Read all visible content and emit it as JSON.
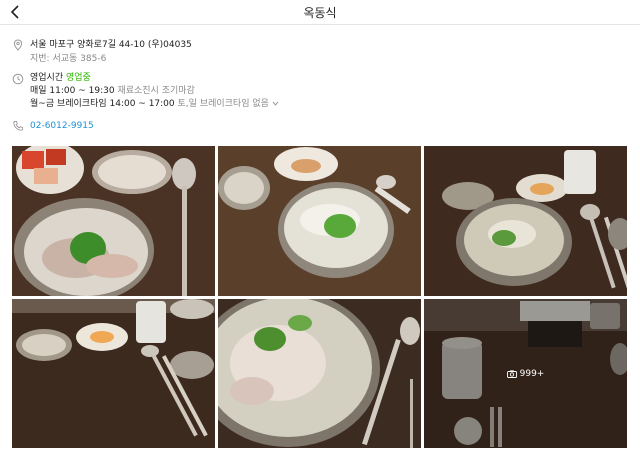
{
  "header": {
    "title": "옥동식",
    "back_icon": "chevron-left-icon"
  },
  "info": {
    "address": "서울 마포구 양화로7길 44-10 (우)04035",
    "lot_address": "지번: 서교동 385-6",
    "hours_label": "영업시간",
    "hours_status": "영업중",
    "daily_hours": "매일 11:00 ~ 19:30",
    "daily_note": "재료소진시 조기마감",
    "break_time": "월~금 브레이크타임 14:00 ~ 17:00",
    "break_note": "토,일 브레이크타임 없음",
    "phone": "02-6012-9915",
    "status_color": "#2db400",
    "link_color": "#1e90d6"
  },
  "gallery": {
    "more_count": "999+",
    "photos": [
      "photo-soup-topdown",
      "photo-soup-bowl",
      "photo-table-setting",
      "photo-side-dishes",
      "photo-soup-closeup",
      "photo-restaurant-interior"
    ]
  }
}
